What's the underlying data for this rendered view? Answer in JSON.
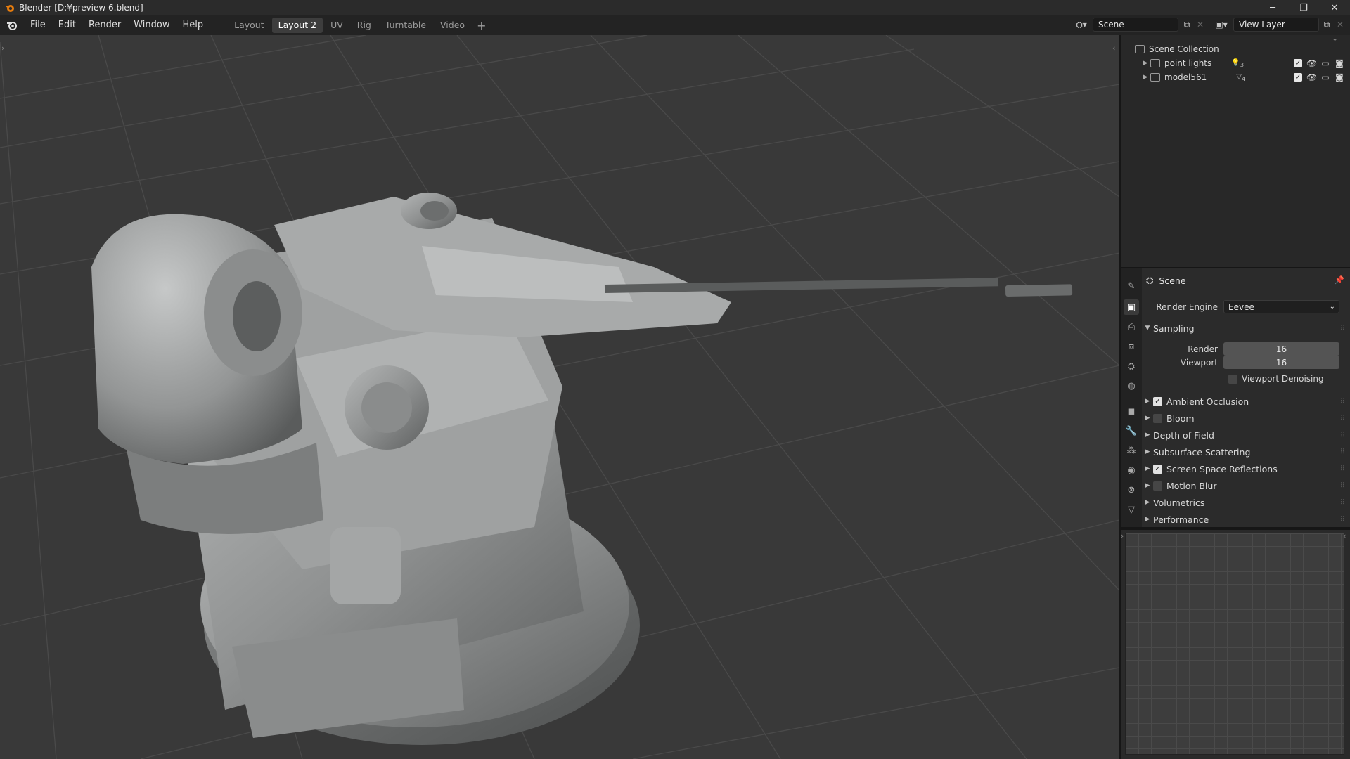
{
  "window": {
    "title": "Blender [D:¥preview 6.blend]",
    "controls": [
      "minimize-icon",
      "restore-icon",
      "close-icon"
    ]
  },
  "menubar": {
    "items": [
      "File",
      "Edit",
      "Render",
      "Window",
      "Help"
    ],
    "workspaces": [
      "Layout",
      "Layout 2",
      "UV",
      "Rig",
      "Turntable",
      "Video"
    ],
    "active_workspace": "Layout 2",
    "add_label": "+"
  },
  "header_right": {
    "scene_name": "Scene",
    "view_layer_name": "View Layer"
  },
  "outliner": {
    "root": "Scene Collection",
    "rows": [
      {
        "label": "point lights",
        "badge": "3"
      },
      {
        "label": "model561",
        "badge": "4"
      }
    ]
  },
  "properties": {
    "header": "Scene",
    "render_engine_label": "Render Engine",
    "render_engine_value": "Eevee",
    "sampling_label": "Sampling",
    "render_label": "Render",
    "render_value": "16",
    "viewport_label": "Viewport",
    "viewport_value": "16",
    "viewport_denoising_label": "Viewport Denoising",
    "panels": [
      {
        "label": "Ambient Occlusion",
        "checkbox": true,
        "checked": true
      },
      {
        "label": "Bloom",
        "checkbox": true,
        "checked": false
      },
      {
        "label": "Depth of Field",
        "checkbox": false,
        "checked": false
      },
      {
        "label": "Subsurface Scattering",
        "checkbox": false,
        "checked": false
      },
      {
        "label": "Screen Space Reflections",
        "checkbox": true,
        "checked": true
      },
      {
        "label": "Motion Blur",
        "checkbox": true,
        "checked": false
      },
      {
        "label": "Volumetrics",
        "checkbox": false,
        "checked": false
      },
      {
        "label": "Performance",
        "checkbox": false,
        "checked": false
      }
    ]
  },
  "colors": {
    "accent": "#4772b3",
    "viewport_bg": "#393939",
    "model": "#9a9c9c"
  }
}
